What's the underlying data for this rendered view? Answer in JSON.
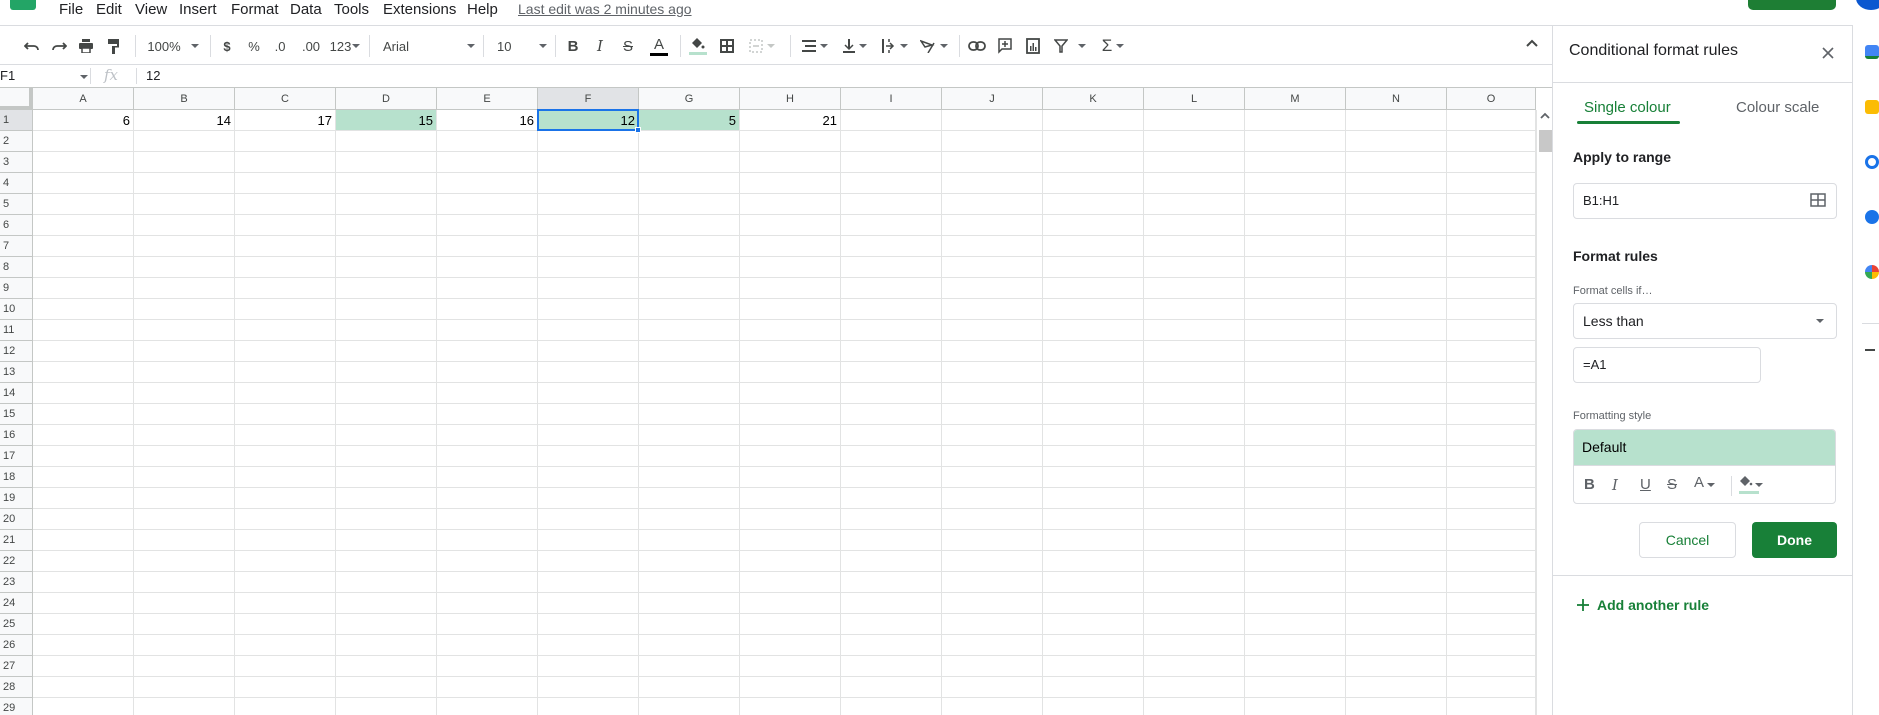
{
  "menubar": {
    "items": [
      "File",
      "Edit",
      "View",
      "Insert",
      "Format",
      "Data",
      "Tools",
      "Extensions",
      "Help"
    ],
    "last_edit": "Last edit was 2 minutes ago"
  },
  "toolbar": {
    "zoom": "100%",
    "currency": "$",
    "percent": "%",
    "decrease_decimals": ".0",
    "increase_decimals": ".00",
    "more_formats": "123",
    "font": "Arial",
    "font_size": "10",
    "bold": "B",
    "italic": "I",
    "strikethrough": "S",
    "text_color": "A"
  },
  "formula_bar": {
    "name_box": "F1",
    "fx": "fx",
    "value": "12"
  },
  "grid": {
    "columns": [
      "A",
      "B",
      "C",
      "D",
      "E",
      "F",
      "G",
      "H",
      "I",
      "J",
      "K",
      "L",
      "M",
      "N",
      "O"
    ],
    "selected_column": "F",
    "rows": [
      "1",
      "2",
      "3",
      "4",
      "5",
      "6",
      "7",
      "8",
      "9",
      "10",
      "11",
      "12",
      "13",
      "14",
      "15",
      "16",
      "17",
      "18",
      "19",
      "20",
      "21",
      "22",
      "23",
      "24",
      "25",
      "26",
      "27",
      "28",
      "29"
    ],
    "row1_values": [
      "6",
      "14",
      "17",
      "15",
      "16",
      "12",
      "5",
      "21",
      "",
      "",
      "",
      "",
      "",
      "",
      ""
    ],
    "highlighted_columns": [
      "D",
      "F",
      "G"
    ],
    "highlight_color": "#b7e1cd",
    "selected_cell": "F1"
  },
  "panel": {
    "title": "Conditional format rules",
    "tabs": [
      {
        "label": "Single colour",
        "active": true
      },
      {
        "label": "Colour scale",
        "active": false
      }
    ],
    "apply_to_range_label": "Apply to range",
    "range_value": "B1:H1",
    "format_rules_label": "Format rules",
    "format_cells_if_label": "Format cells if…",
    "condition": "Less than",
    "condition_value": "=A1",
    "formatting_style_label": "Formatting style",
    "style_preview": "Default",
    "style_tools": {
      "bold": "B",
      "italic": "I",
      "underline": "U",
      "strikethrough": "S",
      "text_color": "A"
    },
    "cancel_label": "Cancel",
    "done_label": "Done",
    "add_rule_label": "Add another rule",
    "accent_color": "#188038"
  }
}
